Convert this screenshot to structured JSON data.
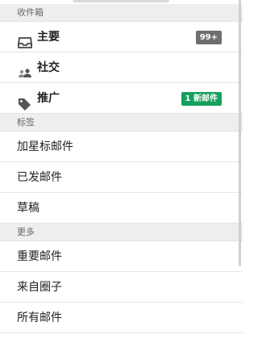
{
  "colors": {
    "section_bg": "#eeeeee",
    "badge_grey": "#6f6f6f",
    "badge_green": "#16a05d",
    "text": "#222222"
  },
  "sections": {
    "inbox_header": "收件箱",
    "labels_header": "标签",
    "more_header": "更多"
  },
  "inbox": {
    "primary": {
      "label": "主要",
      "icon": "inbox-tray-icon",
      "badge": "99+"
    },
    "social": {
      "label": "社交",
      "icon": "people-icon"
    },
    "promotions": {
      "label": "推广",
      "icon": "tag-icon",
      "badge": "1 新邮件"
    }
  },
  "labels": [
    {
      "label": "加星标邮件"
    },
    {
      "label": "已发邮件"
    },
    {
      "label": "草稿"
    }
  ],
  "more": [
    {
      "label": "重要邮件"
    },
    {
      "label": "来自圈子"
    },
    {
      "label": "所有邮件"
    }
  ],
  "scroll": {
    "visible_fraction": 0.77
  }
}
